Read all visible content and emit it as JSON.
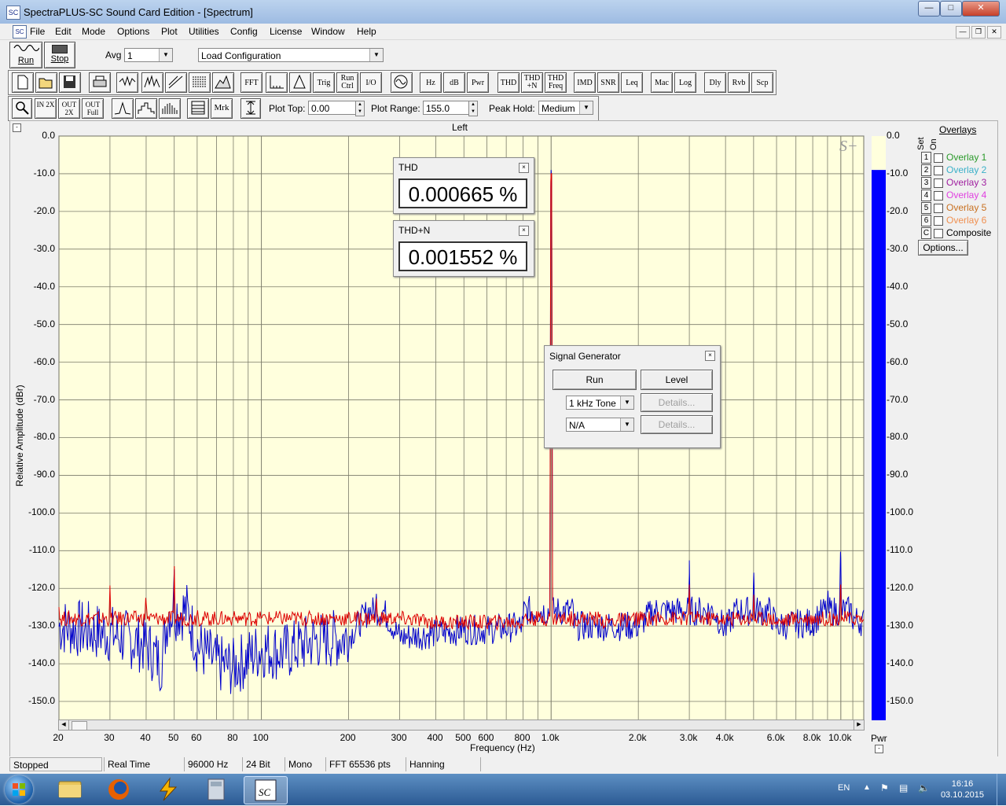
{
  "window": {
    "title": "SpectraPLUS-SC Sound Card Edition - [Spectrum]",
    "app_icon": "sc-logo-icon"
  },
  "menu": [
    "File",
    "Edit",
    "Mode",
    "Options",
    "Plot",
    "Utilities",
    "Config",
    "License",
    "Window",
    "Help"
  ],
  "toolbar1": {
    "run_label": "Run",
    "stop_label": "Stop",
    "avg_label": "Avg",
    "avg_value": "1",
    "config_value": "Load Configuration"
  },
  "toolbar2": {
    "buttons": [
      "FFT",
      "Trig",
      "Run Ctrl",
      "I/O",
      "Hz",
      "dB",
      "Pwr",
      "THD",
      "THD +N",
      "THD Freq",
      "IMD",
      "SNR",
      "Leq",
      "Mac",
      "Log",
      "Dly",
      "Rvb",
      "Scp"
    ]
  },
  "toolbar3": {
    "zoom_buttons": [
      "IN 2X",
      "OUT 2X",
      "OUT Full"
    ],
    "mrk_label": "Mrk",
    "plot_top_label": "Plot Top:",
    "plot_top_value": "0.00",
    "plot_range_label": "Plot Range:",
    "plot_range_value": "155.0",
    "peak_hold_label": "Peak Hold:",
    "peak_hold_value": "Medium"
  },
  "plot": {
    "channel_label": "Left",
    "ylabel": "Relative Amplitude (dBr)",
    "xlabel": "Frequency (Hz)",
    "watermark": "S+",
    "pwr_label": "Pwr"
  },
  "overlays": {
    "title": "Overlays",
    "set_label": "Set",
    "on_label": "On",
    "items": [
      {
        "num": "1",
        "label": "Overlay 1",
        "color": "#2a9a2a"
      },
      {
        "num": "2",
        "label": "Overlay 2",
        "color": "#3ab0c8"
      },
      {
        "num": "3",
        "label": "Overlay 3",
        "color": "#a020a0"
      },
      {
        "num": "4",
        "label": "Overlay 4",
        "color": "#e040e0"
      },
      {
        "num": "5",
        "label": "Overlay 5",
        "color": "#c87020"
      },
      {
        "num": "6",
        "label": "Overlay 6",
        "color": "#f09050"
      },
      {
        "num": "C",
        "label": "Composite",
        "color": "#000000"
      }
    ],
    "options_label": "Options..."
  },
  "thd_meter": {
    "title": "THD",
    "value": "0.000665 %"
  },
  "thdn_meter": {
    "title": "THD+N",
    "value": "0.001552 %"
  },
  "signal_generator": {
    "title": "Signal Generator",
    "run_label": "Run",
    "level_label": "Level",
    "wave_value": "1 kHz Tone",
    "mode_value": "N/A",
    "details_label": "Details..."
  },
  "status": [
    "Stopped",
    "Real Time",
    "96000 Hz",
    "24 Bit",
    "Mono",
    "FFT 65536 pts",
    "Hanning"
  ],
  "taskbar": {
    "icons": [
      "start-orb-icon",
      "file-explorer-icon",
      "firefox-icon",
      "winamp-icon",
      "calculator-icon",
      "spectraplus-icon"
    ],
    "lang": "EN",
    "time": "16:16",
    "date": "03.10.2015"
  },
  "chart_data": {
    "type": "line",
    "title": "Left",
    "xlabel": "Frequency (Hz)",
    "ylabel": "Relative Amplitude (dBr)",
    "x_scale": "log",
    "xlim": [
      20,
      12000
    ],
    "ylim": [
      -155,
      0
    ],
    "grid": true,
    "x_ticks": [
      "20",
      "30",
      "40",
      "50",
      "60",
      "80",
      "100",
      "200",
      "300",
      "400",
      "500",
      "600",
      "800",
      "1.0k",
      "2.0k",
      "3.0k",
      "4.0k",
      "6.0k",
      "8.0k",
      "10.0k"
    ],
    "x_tick_values": [
      20,
      30,
      40,
      50,
      60,
      80,
      100,
      200,
      300,
      400,
      500,
      600,
      800,
      1000,
      2000,
      3000,
      4000,
      6000,
      8000,
      10000
    ],
    "y_ticks": [
      "0.0",
      "-10.0",
      "-20.0",
      "-30.0",
      "-40.0",
      "-50.0",
      "-60.0",
      "-70.0",
      "-80.0",
      "-90.0",
      "-100.0",
      "-110.0",
      "-120.0",
      "-130.0",
      "-140.0",
      "-150.0"
    ],
    "y_tick_values": [
      0,
      -10,
      -20,
      -30,
      -40,
      -50,
      -60,
      -70,
      -80,
      -90,
      -100,
      -110,
      -120,
      -130,
      -140,
      -150
    ],
    "series": [
      {
        "color": "#0000cc",
        "x": [
          20,
          30,
          40,
          45,
          50,
          60,
          70,
          80,
          100,
          120,
          150,
          200,
          250,
          300,
          400,
          500,
          600,
          800,
          1000,
          1200,
          1500,
          2000,
          3000,
          4000,
          5000,
          6000,
          8000,
          9000,
          10000,
          11000,
          12000
        ],
        "y": [
          -130,
          -132,
          -135,
          -140,
          -115,
          -135,
          -140,
          -141,
          -136,
          -137,
          -134,
          -133,
          -123,
          -133,
          -132,
          -131,
          -131,
          -130,
          -9,
          -130,
          -130,
          -130,
          -116,
          -131,
          -117,
          -130,
          -129,
          -125,
          -112,
          -128,
          -129
        ]
      },
      {
        "color": "#dd0000",
        "x": [
          20,
          30,
          40,
          50,
          60,
          80,
          100,
          150,
          200,
          250,
          300,
          400,
          500,
          600,
          800,
          1000,
          1500,
          2000,
          3000,
          4000,
          5000,
          6000,
          8000,
          10000,
          12000
        ],
        "y": [
          -123,
          -121,
          -124,
          -116,
          -126,
          -126,
          -127,
          -128,
          -128,
          -123,
          -128,
          -129,
          -129,
          -129,
          -129,
          -10,
          -129,
          -128,
          -119,
          -129,
          -121,
          -129,
          -127,
          -119,
          -129
        ]
      }
    ],
    "pwr_bar": {
      "value": -9,
      "color": "#0000ff"
    },
    "pwr_ticks": [
      "0.0",
      "-10.0",
      "-20.0",
      "-30.0",
      "-40.0",
      "-50.0",
      "-60.0",
      "-70.0",
      "-80.0",
      "-90.0",
      "-100.0",
      "-110.0",
      "-120.0",
      "-130.0",
      "-140.0",
      "-150.0"
    ]
  }
}
